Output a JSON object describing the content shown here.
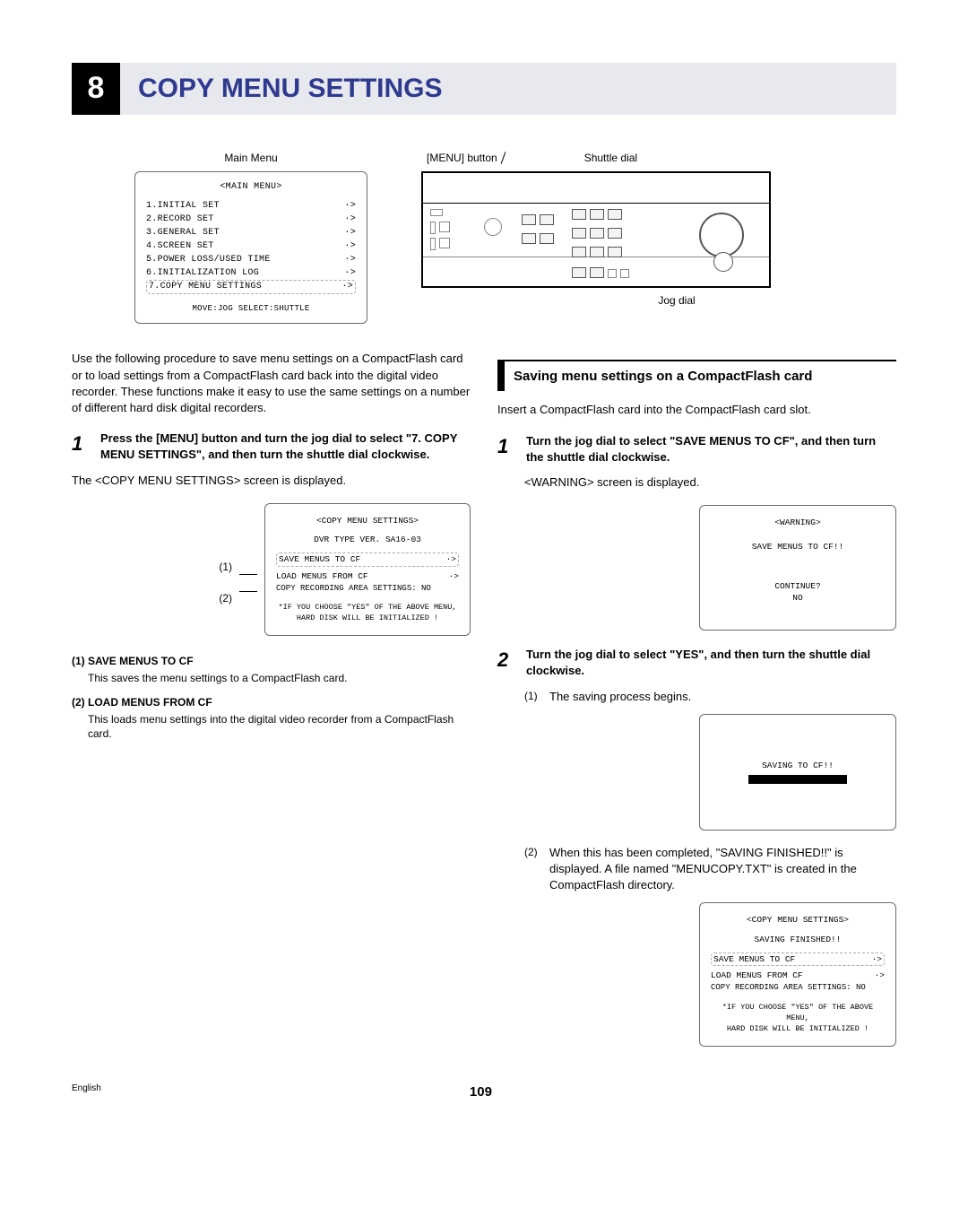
{
  "chapter": {
    "number": "8",
    "title": "COPY MENU SETTINGS"
  },
  "labels": {
    "main_menu": "Main Menu",
    "menu_button": "[MENU] button",
    "shuttle_dial": "Shuttle dial",
    "jog_dial": "Jog dial"
  },
  "main_menu_osd": {
    "title": "<MAIN MENU>",
    "items": [
      {
        "l": "1.INITIAL SET",
        "r": "·>"
      },
      {
        "l": "2.RECORD SET",
        "r": "·>"
      },
      {
        "l": "3.GENERAL SET",
        "r": "·>"
      },
      {
        "l": "4.SCREEN SET",
        "r": "·>"
      },
      {
        "l": "5.POWER LOSS/USED TIME",
        "r": "·>"
      },
      {
        "l": "6.INITIALIZATION LOG",
        "r": "·>"
      }
    ],
    "highlight": {
      "l": "7.COPY MENU SETTINGS",
      "r": "·>"
    },
    "footer": "MOVE:JOG  SELECT:SHUTTLE"
  },
  "intro_paragraph": "Use the following procedure to save menu settings on a CompactFlash card or to load settings from a CompactFlash card back into the digital video recorder. These functions make it easy to use the same settings on a number of different hard disk digital recorders.",
  "left_step1": {
    "num": "1",
    "text": "Press the [MENU] button and turn the jog dial to select \"7. COPY MENU SETTINGS\", and then turn the shuttle dial clockwise.",
    "after": "The <COPY MENU SETTINGS> screen is displayed."
  },
  "copy_menu_osd": {
    "title": "<COPY MENU SETTINGS>",
    "ver": "DVR TYPE VER. SA16-03",
    "row1": {
      "tag": "(1)",
      "l": "SAVE MENUS TO CF",
      "r": "·>"
    },
    "row2": {
      "tag": "(2)",
      "l": "LOAD MENUS FROM CF",
      "r": "·>"
    },
    "copy_area": "COPY RECORDING AREA SETTINGS: NO",
    "warn1": "*IF YOU CHOOSE \"YES\" OF THE ABOVE MENU,",
    "warn2": "HARD DISK WILL BE INITIALIZED !"
  },
  "defs": {
    "d1head": "(1) SAVE MENUS TO CF",
    "d1body": "This saves the menu settings to a CompactFlash card.",
    "d2head": "(2) LOAD MENUS FROM CF",
    "d2body": "This loads menu settings into the digital video recorder from a CompactFlash card."
  },
  "subsection": {
    "title": "Saving menu settings on a CompactFlash card",
    "insert": "Insert a CompactFlash card into the CompactFlash card slot."
  },
  "right_step1": {
    "num": "1",
    "text": "Turn the jog dial to select \"SAVE MENUS TO CF\", and then turn the shuttle dial clockwise.",
    "after": "<WARNING> screen is displayed."
  },
  "warning_osd": {
    "title": "<WARNING>",
    "line1": "SAVE MENUS TO CF!!",
    "cont": "CONTINUE?",
    "no": "NO"
  },
  "right_step2": {
    "num": "2",
    "text": "Turn the jog dial to select \"YES\", and then turn the shuttle dial clockwise.",
    "sub1tag": "(1)",
    "sub1": "The saving process begins."
  },
  "saving_osd": {
    "line": "SAVING TO CF!!"
  },
  "right_step2b": {
    "sub2tag": "(2)",
    "sub2": "When this has been completed, \"SAVING FINISHED!!\" is displayed. A file named \"MENUCOPY.TXT\" is created in the CompactFlash directory."
  },
  "finished_osd": {
    "title": "<COPY MENU SETTINGS>",
    "fin": "SAVING FINISHED!!",
    "row1": {
      "l": "SAVE MENUS TO CF",
      "r": "·>"
    },
    "row2": {
      "l": "LOAD MENUS FROM CF",
      "r": "·>"
    },
    "copy_area": "COPY RECORDING AREA SETTINGS: NO",
    "warn1": "*IF YOU CHOOSE \"YES\" OF THE ABOVE MENU,",
    "warn2": "HARD DISK WILL BE INITIALIZED !"
  },
  "footer": {
    "lang": "English",
    "page": "109"
  }
}
